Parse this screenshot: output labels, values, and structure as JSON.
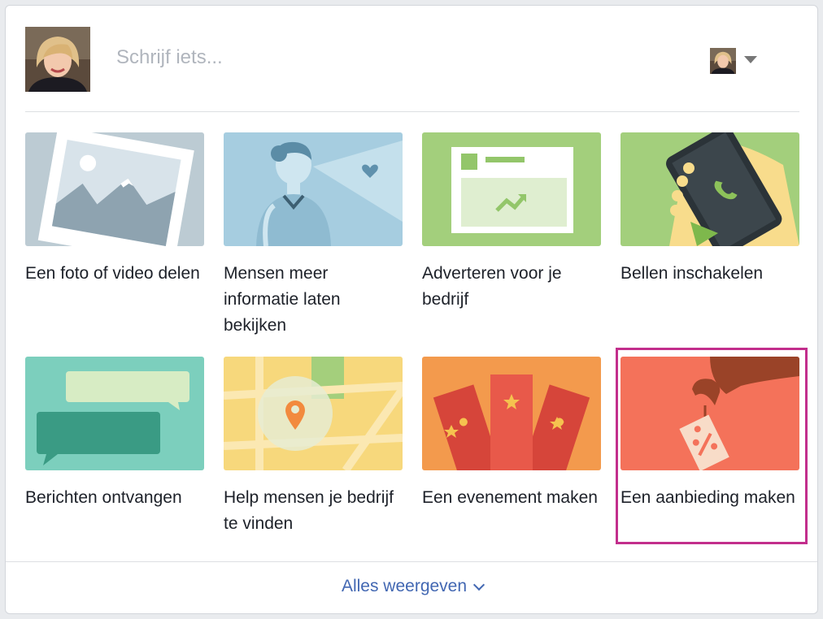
{
  "composer": {
    "placeholder": "Schrijf iets..."
  },
  "tiles": [
    {
      "label": "Een foto of video delen"
    },
    {
      "label": "Mensen meer informatie laten bekijken"
    },
    {
      "label": "Adverteren voor je bedrijf"
    },
    {
      "label": "Bellen inschakelen"
    },
    {
      "label": "Berichten ontvangen"
    },
    {
      "label": "Help mensen je bedrijf te vinden"
    },
    {
      "label": "Een evenement maken"
    },
    {
      "label": "Een aanbieding maken"
    }
  ],
  "footer": {
    "show_all_label": "Alles weergeven"
  },
  "colors": {
    "link": "#4267b2",
    "highlight": "#c22e8c"
  }
}
